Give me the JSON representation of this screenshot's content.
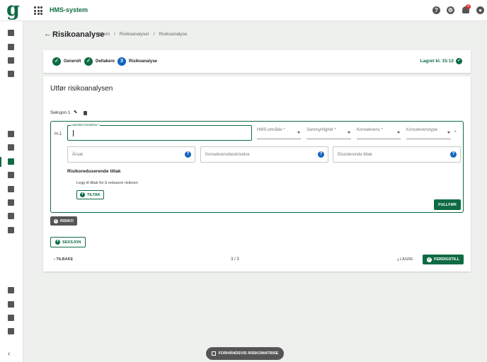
{
  "app": {
    "logo": "g",
    "title": "HMS-system",
    "notifications": "9"
  },
  "header": {
    "title": "Risikoanalyse",
    "breadcrumb": [
      "Hjem",
      "/",
      "Risikoanalyser",
      "/",
      "Risikoanalyse"
    ]
  },
  "stepper": {
    "steps": [
      {
        "label": "Generelt",
        "state": "done"
      },
      {
        "label": "Deltakere",
        "state": "done"
      },
      {
        "label": "Risikoanalyse",
        "state": "active",
        "number": "3"
      }
    ],
    "saved": "Lagret kl. 15:12"
  },
  "main": {
    "title": "Utfør risikoanalysen",
    "section_label": "Seksjon 1",
    "risk": {
      "id": "H-1",
      "event_label": "Uønsket hendelse *",
      "event_value": "",
      "selects": [
        "HMS-område *",
        "Sannsynlighet *",
        "Konsekvens *",
        "Konsekvenstype"
      ],
      "fields": [
        {
          "placeholder": "Årsak"
        },
        {
          "placeholder": "Konsekvensbeskrivelse"
        },
        {
          "placeholder": "Eksisterende tiltak"
        }
      ],
      "tiltak_title": "Risikoreduserende tiltak",
      "tiltak_hint": "Legg til tiltak for å redusere risikoen",
      "tiltak_button": "TILTAK",
      "complete_button": "FULLFØR"
    },
    "add_risk_button": "RISIKO",
    "add_section_button": "SEKSJON",
    "footer": {
      "back": "TILBAKE",
      "pager": "3 / 3",
      "save": "LAGRE",
      "finish": "FERDIGSTILL"
    }
  },
  "preview_button": "FORHÅNDSVIS RISIKOMATRISE",
  "colors": {
    "brand": "#0f6b43",
    "info": "#1565c0",
    "dark_button": "#555555"
  },
  "icons": {
    "sidebar": [
      "home-icon",
      "folder-icon",
      "document-icon",
      "list-icon",
      "branch-icon",
      "gavel-icon",
      "shield-document-icon",
      "briefcase-icon",
      "security-icon",
      "book-icon",
      "history-icon",
      "dashboard-icon",
      "handshake-icon",
      "person-icon",
      "people-icon",
      "building-icon",
      "collapse-icon"
    ]
  }
}
